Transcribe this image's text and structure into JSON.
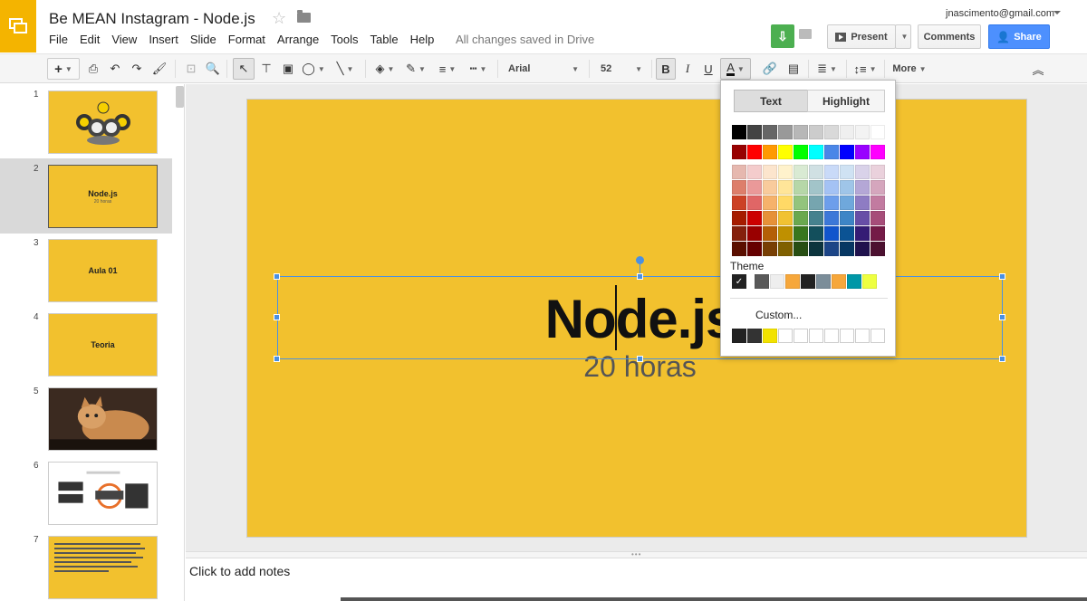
{
  "app": {
    "title": "Be MEAN Instagram - Node.js",
    "saved_status": "All changes saved in Drive",
    "user_email": "jnascimento@gmail.com"
  },
  "menu": [
    "File",
    "Edit",
    "View",
    "Insert",
    "Slide",
    "Format",
    "Arrange",
    "Tools",
    "Table",
    "Help"
  ],
  "header_buttons": {
    "present": "Present",
    "comments": "Comments",
    "share": "Share"
  },
  "toolbar": {
    "font_family": "Arial",
    "font_size": "52",
    "bold_label": "B",
    "italic_label": "I",
    "underline_label": "U",
    "text_color_label": "A",
    "more_label": "More"
  },
  "slides": [
    {
      "number": "1",
      "title": "",
      "subtitle": "",
      "kind": "bees"
    },
    {
      "number": "2",
      "title": "Node.js",
      "subtitle": "20 horas",
      "kind": "title"
    },
    {
      "number": "3",
      "title": "Aula 01",
      "subtitle": "",
      "kind": "title"
    },
    {
      "number": "4",
      "title": "Teoria",
      "subtitle": "",
      "kind": "title"
    },
    {
      "number": "5",
      "title": "",
      "subtitle": "",
      "kind": "photo"
    },
    {
      "number": "6",
      "title": "",
      "subtitle": "",
      "kind": "diagram"
    },
    {
      "number": "7",
      "title": "",
      "subtitle": "",
      "kind": "text"
    }
  ],
  "active_slide": 2,
  "canvas": {
    "title": "Node.js",
    "subtitle": "20 horas",
    "background": "#f2c12e"
  },
  "notes_placeholder": "Click to add notes",
  "color_picker": {
    "tab_text": "Text",
    "tab_highlight": "Highlight",
    "theme_label": "Theme",
    "custom_label": "Custom...",
    "grayscale": [
      "#000000",
      "#434343",
      "#666666",
      "#999999",
      "#b7b7b7",
      "#cccccc",
      "#d9d9d9",
      "#efefef",
      "#f3f3f3",
      "#ffffff"
    ],
    "bright": [
      "#980000",
      "#ff0000",
      "#ff9900",
      "#ffff00",
      "#00ff00",
      "#00ffff",
      "#4a86e8",
      "#0000ff",
      "#9900ff",
      "#ff00ff"
    ],
    "shades": [
      [
        "#e6b8af",
        "#f4cccc",
        "#fce5cd",
        "#fff2cc",
        "#d9ead3",
        "#d0e0e3",
        "#c9daf8",
        "#cfe2f3",
        "#d9d2e9",
        "#ead1dc"
      ],
      [
        "#dd7e6b",
        "#ea9999",
        "#f9cb9c",
        "#ffe599",
        "#b6d7a8",
        "#a2c4c9",
        "#a4c2f4",
        "#9fc5e8",
        "#b4a7d6",
        "#d5a6bd"
      ],
      [
        "#cc4125",
        "#e06666",
        "#f6b26b",
        "#ffd966",
        "#93c47d",
        "#76a5af",
        "#6d9eeb",
        "#6fa8dc",
        "#8e7cc3",
        "#c27ba0"
      ],
      [
        "#a61c00",
        "#cc0000",
        "#e69138",
        "#f1c232",
        "#6aa84f",
        "#45818e",
        "#3c78d8",
        "#3d85c6",
        "#674ea7",
        "#a64d79"
      ],
      [
        "#85200c",
        "#990000",
        "#b45f06",
        "#bf9000",
        "#38761d",
        "#134f5c",
        "#1155cc",
        "#0b5394",
        "#351c75",
        "#741b47"
      ],
      [
        "#5b0f00",
        "#660000",
        "#783f04",
        "#7f6000",
        "#274e13",
        "#0c343d",
        "#1c4587",
        "#073763",
        "#20124d",
        "#4c1130"
      ]
    ],
    "theme": [
      "#ffffff",
      "#595959",
      "#eeeeee",
      "#f6a73b",
      "#222222",
      "#7b8d99",
      "#f6a73b",
      "#0097a7",
      "#eeff41"
    ],
    "recent": [
      "#222222",
      "#333333",
      "#f2e200"
    ]
  }
}
